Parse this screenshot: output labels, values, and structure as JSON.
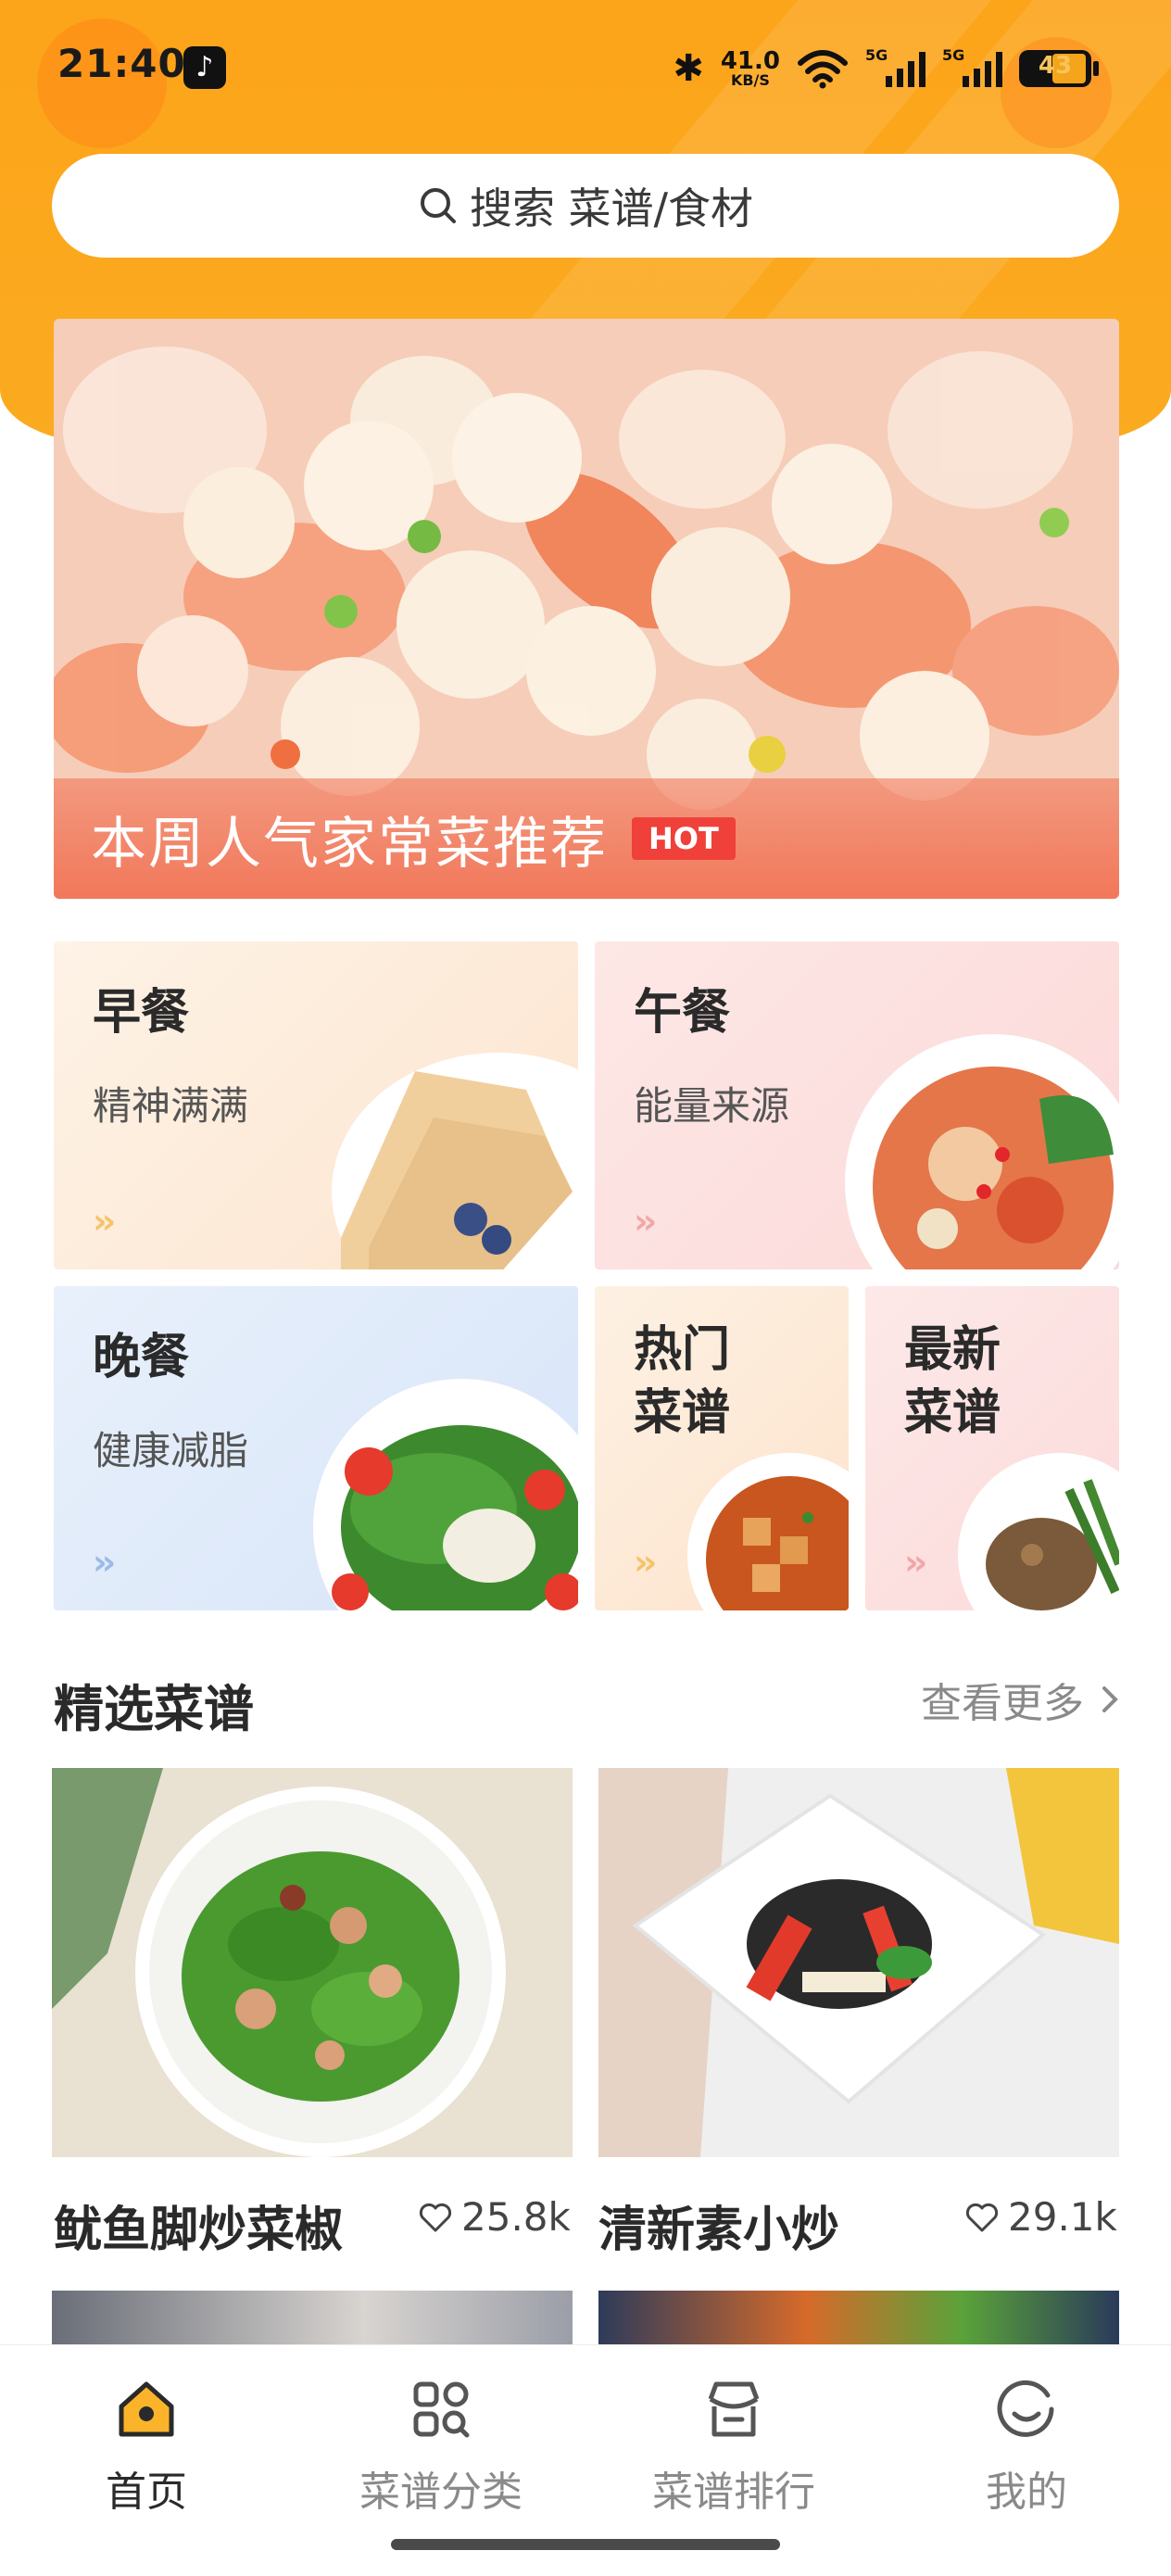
{
  "status_bar": {
    "time": "21:40",
    "net_speed": "41.0",
    "net_unit": "KB/S",
    "signal_1": "5G",
    "signal_2": "5G",
    "battery": "43",
    "icons": [
      "tiktok-icon",
      "bluetooth-icon",
      "wifi-icon",
      "signal-icon",
      "battery-icon"
    ]
  },
  "search": {
    "placeholder": "搜索 菜谱/食材"
  },
  "banner": {
    "title": "本周人气家常菜推荐",
    "badge": "HOT"
  },
  "categories": [
    {
      "title": "早餐",
      "subtitle": "精神满满"
    },
    {
      "title": "午餐",
      "subtitle": "能量来源"
    },
    {
      "title": "晚餐",
      "subtitle": "健康减脂"
    },
    {
      "title": "热门\n菜谱"
    },
    {
      "title": "最新\n菜谱"
    }
  ],
  "featured": {
    "title": "精选菜谱",
    "more": "查看更多",
    "recipes": [
      {
        "name": "鱿鱼脚炒菜椒",
        "likes": "25.8k"
      },
      {
        "name": "清新素小炒",
        "likes": "29.1k"
      }
    ]
  },
  "nav": [
    {
      "label": "首页",
      "active": true
    },
    {
      "label": "菜谱分类",
      "active": false
    },
    {
      "label": "菜谱排行",
      "active": false
    },
    {
      "label": "我的",
      "active": false
    }
  ],
  "colors": {
    "brand": "#fca41a",
    "hot": "#f0403a",
    "accent_yellow": "#fbc34a"
  }
}
